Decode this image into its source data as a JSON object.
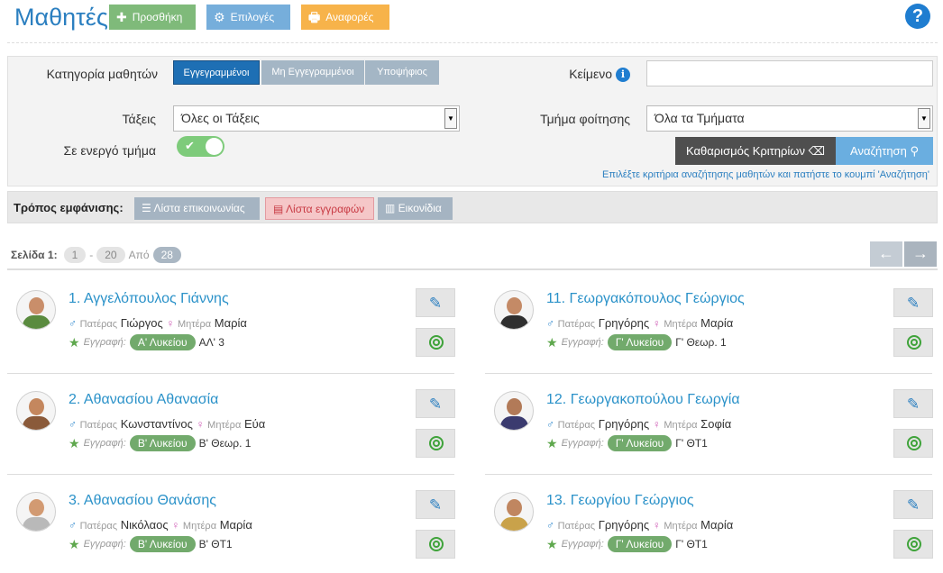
{
  "header": {
    "title": "Μαθητές",
    "add_label": "Προσθήκη",
    "options_label": "Επιλογές",
    "reports_label": "Αναφορές",
    "help": "?"
  },
  "filters": {
    "category_label": "Κατηγορία μαθητών",
    "segments": [
      "Εγγεγραμμένοι",
      "Μη Εγγεγραμμένοι",
      "Υποψήφιος"
    ],
    "text_label": "Κείμενο",
    "text_value": "",
    "classes_label": "Τάξεις",
    "classes_value": "Όλες οι Τάξεις",
    "dept_label": "Τμήμα φοίτησης",
    "dept_value": "Όλα τα Τμήματα",
    "active_label": "Σε ενεργό τμήμα",
    "active_on": true,
    "clear_label": "Καθαρισμός Κριτηρίων",
    "search_label": "Αναζήτηση",
    "hint": "Επιλέξτε κριτήρια αναζήτησης μαθητών και πατήστε το κουμπί 'Αναζήτηση'"
  },
  "view": {
    "label": "Τρόπος εμφάνισης:",
    "options": [
      "Λίστα επικοινωνίας",
      "Λίστα εγγραφών",
      "Εικονίδια"
    ],
    "selected": "Λίστα εγγραφών"
  },
  "pager": {
    "label": "Σελίδα 1:",
    "from": "1",
    "dash": "-",
    "to": "20",
    "of_label": "Από",
    "total": "28",
    "prev": "←",
    "next": "→"
  },
  "labels": {
    "father": "Πατέρας",
    "mother": "Μητέρα",
    "enrollment": "Εγγραφή:"
  },
  "students": [
    {
      "name": "1. Αγγελόπουλος Γιάννης",
      "father": "Γιώργος",
      "mother": "Μαρία",
      "grade": "Α' Λυκείου",
      "section": "ΑΛ' 3"
    },
    {
      "name": "2. Αθανασίου Αθανασία",
      "father": "Κωνσταντίνος",
      "mother": "Εύα",
      "grade": "Β' Λυκείου",
      "section": "Β' Θεωρ. 1"
    },
    {
      "name": "3. Αθανασίου Θανάσης",
      "father": "Νικόλαος",
      "mother": "Μαρία",
      "grade": "Β' Λυκείου",
      "section": "Β' ΘΤ1"
    },
    {
      "name": "11. Γεωργακόπουλος Γεώργιος",
      "father": "Γρηγόρης",
      "mother": "Μαρία",
      "grade": "Γ' Λυκείου",
      "section": "Γ' Θεωρ. 1"
    },
    {
      "name": "12. Γεωργακοπούλου Γεωργία",
      "father": "Γρηγόρης",
      "mother": "Σοφία",
      "grade": "Γ' Λυκείου",
      "section": "Γ' ΘΤ1"
    },
    {
      "name": "13. Γεωργίου Γεώργιος",
      "father": "Γρηγόρης",
      "mother": "Μαρία",
      "grade": "Γ' Λυκείου",
      "section": "Γ' ΘΤ1"
    }
  ],
  "colors": {
    "accent": "#2b7fc0",
    "add": "#7fba7a",
    "options": "#76aedb",
    "reports": "#f7b34a",
    "grade_pill": "#72aa6c"
  }
}
